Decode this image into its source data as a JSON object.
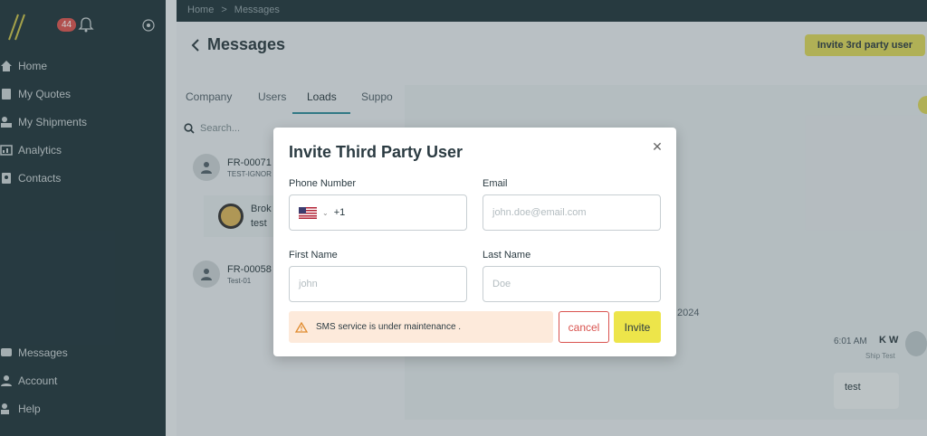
{
  "sidebar": {
    "notification_count": "44",
    "top_items": [
      {
        "label": "Home",
        "icon": "home-icon"
      },
      {
        "label": "My Quotes",
        "icon": "quote-icon"
      },
      {
        "label": "My Shipments",
        "icon": "shipment-icon"
      },
      {
        "label": "Analytics",
        "icon": "analytics-icon"
      },
      {
        "label": "Contacts",
        "icon": "contacts-icon"
      }
    ],
    "bottom_items": [
      {
        "label": "Messages",
        "icon": "messages-icon"
      },
      {
        "label": "Account",
        "icon": "account-icon"
      },
      {
        "label": "Help",
        "icon": "help-icon"
      }
    ]
  },
  "breadcrumb": {
    "home": "Home",
    "sep": ">",
    "current": "Messages"
  },
  "page": {
    "title": "Messages",
    "invite_3p_label": "Invite 3rd party user"
  },
  "tabs": [
    "Company",
    "Users",
    "Loads",
    "Suppo"
  ],
  "search": {
    "placeholder": "Search..."
  },
  "list": [
    {
      "title": "FR-00071",
      "sub": "TEST-IGNOR"
    },
    {
      "title": "FR-00058",
      "sub": "Test-01"
    }
  ],
  "broker": {
    "line1": "Brok",
    "line2": "test"
  },
  "chat": {
    "date_fragment": "2024",
    "time": "6:01 AM",
    "name": "K W",
    "sub": "Ship Test",
    "message": "test"
  },
  "modal": {
    "title": "Invite Third Party User",
    "phone_label": "Phone Number",
    "phone_code": "+1",
    "email_label": "Email",
    "email_placeholder": "john.doe@email.com",
    "first_label": "First Name",
    "first_placeholder": "john",
    "last_label": "Last Name",
    "last_placeholder": "Doe",
    "alert": "SMS service is under maintenance .",
    "cancel": "cancel",
    "invite": "Invite"
  },
  "colors": {
    "sidebar": "#20363d",
    "accent": "#ede54a",
    "danger": "#d9534f",
    "alert_bg": "#fdeadb"
  }
}
